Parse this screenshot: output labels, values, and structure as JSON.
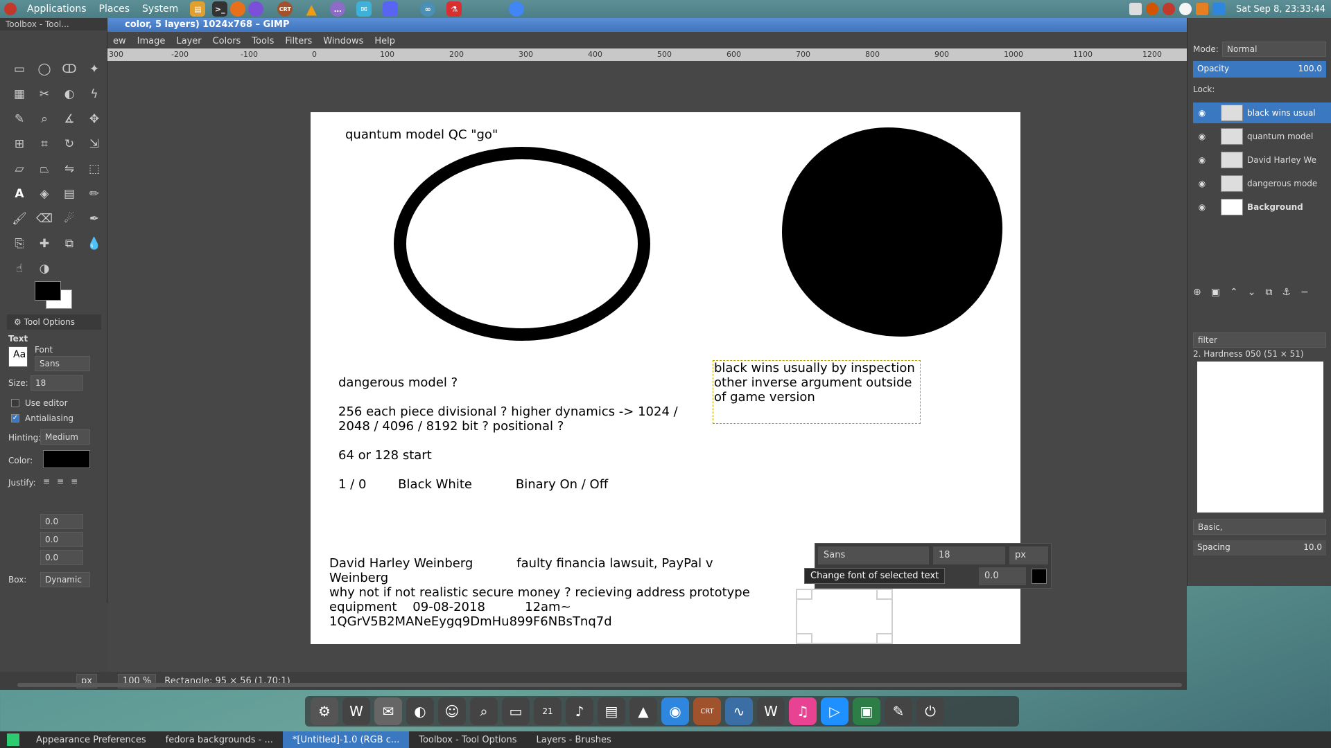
{
  "top_panel": {
    "menus": [
      "Applications",
      "Places",
      "System"
    ],
    "clock": "Sat Sep 8, 23:33:44"
  },
  "gimp": {
    "title": "color, 5 layers) 1024x768 – GIMP",
    "menus": [
      "ew",
      "Image",
      "Layer",
      "Colors",
      "Tools",
      "Filters",
      "Windows",
      "Help"
    ],
    "ruler_ticks": [
      "300",
      "-200",
      "-100",
      "0",
      "100",
      "200",
      "300",
      "400",
      "500",
      "600",
      "700",
      "800",
      "900",
      "1000",
      "1100",
      "1200"
    ],
    "status": {
      "unit": "px",
      "zoom": "100 %",
      "message": "Rectangle: 95 × 56  (1.70:1)"
    }
  },
  "canvas": {
    "title_text": "quantum model QC \"go\"",
    "block1": "dangerous model ?\n\n256 each piece divisional ? higher dynamics -> 1024 /\n2048 / 4096 / 8192 bit ? positional ?\n\n64 or 128 start\n\n1 / 0        Black White           Binary On / Off",
    "block2": "black wins usually by inspection\nother inverse argument outside\nof game version",
    "block3": "David Harley Weinberg           faulty financia lawsuit, PayPal v\nWeinberg\nwhy not if not realistic secure money ? recieving address prototype\nequipment    09-08-2018          12am~\n1QGrV5B2MANeEygq9DmHu899F6NBsTnq7d"
  },
  "text_overlay": {
    "font": "Sans",
    "size": "18",
    "unit": "px",
    "baseline": "0.0",
    "tooltip": "Change font of selected text"
  },
  "toolbox": {
    "title": "Toolbox - Tool...",
    "tab_label": "Tool Options",
    "section": "Text",
    "font_label": "Font",
    "font_value": "Sans",
    "font_icon_text": "Aa",
    "size_label": "Size:",
    "size_value": "18",
    "use_editor": "Use editor",
    "antialiasing": "Antialiasing",
    "hinting_label": "Hinting:",
    "hinting_value": "Medium",
    "color_label": "Color:",
    "justify_label": "Justify:",
    "indent": "0.0",
    "line_spacing": "0.0",
    "letter_spacing": "0.0",
    "box_label": "Box:",
    "box_value": "Dynamic"
  },
  "layers_dock": {
    "mode_label": "Mode:",
    "mode_value": "Normal",
    "opacity_label": "Opacity",
    "opacity_value": "100.0",
    "lock_label": "Lock:",
    "layers": [
      {
        "name": "black wins usual",
        "selected": true
      },
      {
        "name": "quantum model",
        "selected": false
      },
      {
        "name": "David Harley We",
        "selected": false
      },
      {
        "name": "dangerous mode",
        "selected": false
      },
      {
        "name": "Background",
        "selected": false
      }
    ],
    "filter_label": "filter",
    "brush_name": "2. Hardness 050 (51 × 51)",
    "brush_set": "Basic,",
    "spacing_label": "Spacing",
    "spacing_value": "10.0"
  },
  "taskbar": {
    "tasks": [
      {
        "label": "Appearance Preferences",
        "active": false
      },
      {
        "label": "fedora backgrounds - ...",
        "active": false
      },
      {
        "label": "*[Untitled]-1.0 (RGB c...",
        "active": true
      },
      {
        "label": "Toolbox - Tool Options",
        "active": false
      },
      {
        "label": "Layers - Brushes",
        "active": false
      }
    ],
    "dock_badge": "21"
  }
}
